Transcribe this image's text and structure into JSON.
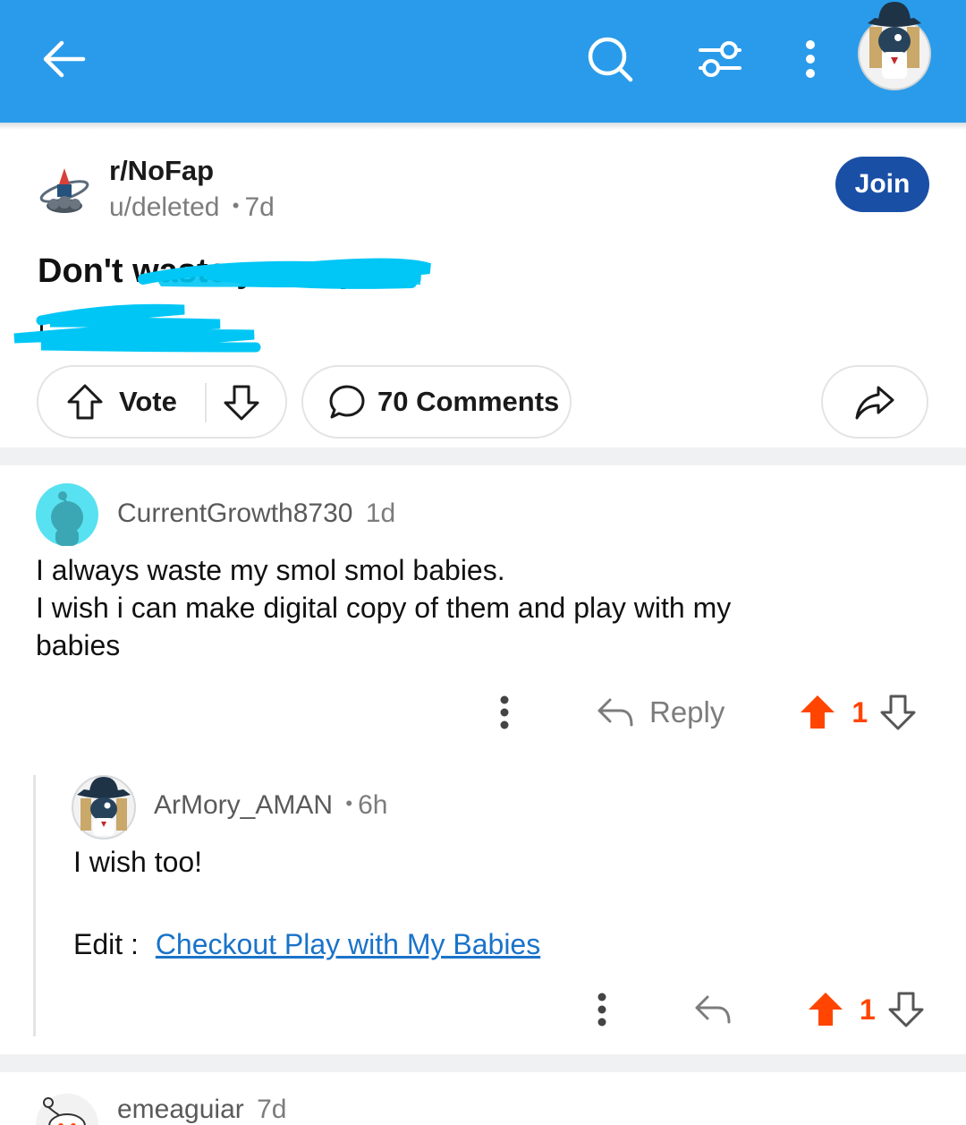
{
  "appbar": {
    "color": "#2a9bea",
    "icons": [
      "back-arrow-icon",
      "search-icon",
      "filter-icon",
      "more-vertical-icon",
      "user-avatar"
    ]
  },
  "post": {
    "subreddit": "r/NoFap",
    "author": "u/deleted",
    "age": "7d",
    "meta_separator": "•",
    "join_label": "Join",
    "title": "Don't waste your sperm",
    "body": "I",
    "vote_label": "Vote",
    "comments_label": "70 Comments"
  },
  "comments": [
    {
      "author": "CurrentGrowth8730",
      "age": "1d",
      "lines": [
        "I always waste my smol smol babies.",
        "I wish i can make digital copy of them and play with my",
        "babies"
      ],
      "reply_label": "Reply",
      "score": "1"
    },
    {
      "author": "ArMory_AMAN",
      "separator": "•",
      "age": "6h",
      "text": "I wish too!",
      "edit_prefix": "Edit :",
      "edit_link": "Checkout Play with My Babies",
      "score": "1"
    },
    {
      "author": "emeaguiar",
      "age": "7d"
    }
  ],
  "colors": {
    "accent": "#2a9bea",
    "join": "#1a4fa6",
    "upvote": "#ff4500",
    "link": "#1a73c9",
    "redaction": "#00c6f5"
  }
}
